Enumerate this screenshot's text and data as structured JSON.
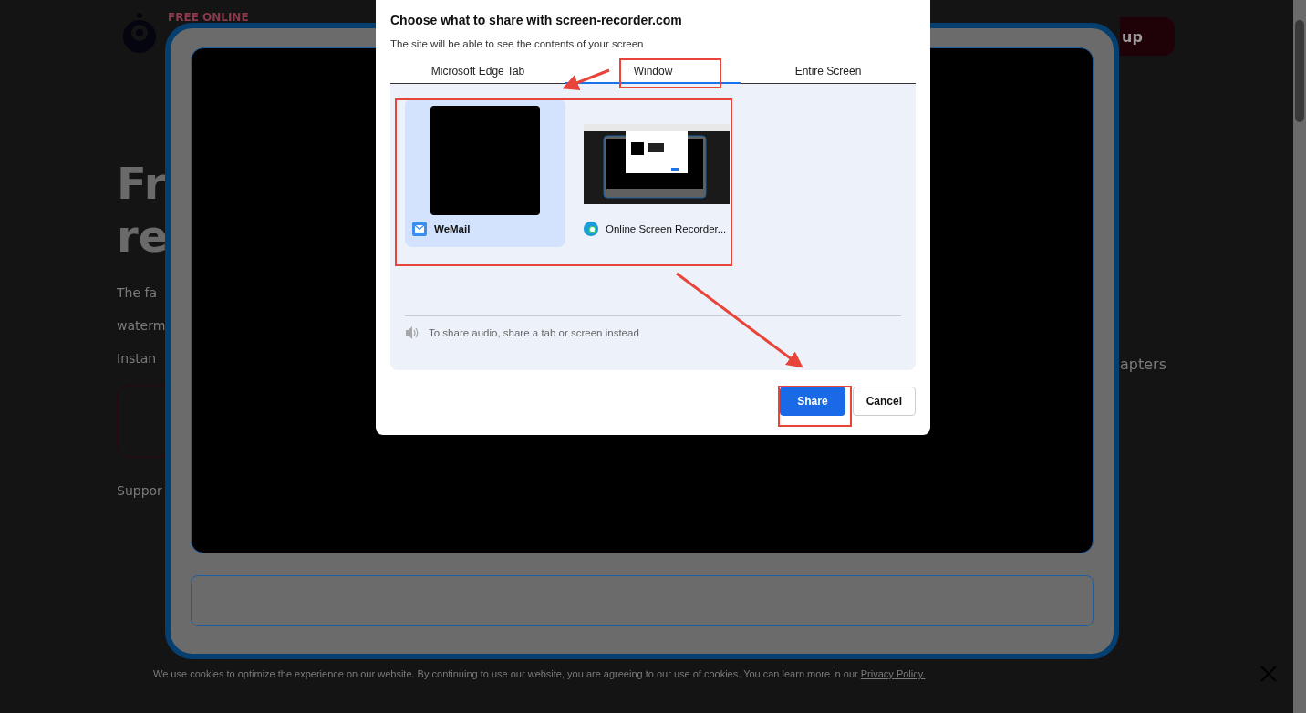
{
  "page": {
    "logo_text": "FREE ONLINE",
    "heading_lines": [
      "Fr",
      "re"
    ],
    "paragraph_lines": [
      "The fa",
      "waterm",
      "Instan"
    ],
    "support_text": "Suppor",
    "signup_button": "up",
    "right_text": "apters"
  },
  "cookie_banner": {
    "text": "We use cookies to optimize the experience on our website. By continuing to use our website, you are agreeing to our use of cookies. You can learn more in our",
    "link": "Privacy Policy."
  },
  "dialog": {
    "title": "Choose what to share with screen-recorder.com",
    "subtitle": "The site will be able to see the contents of your screen",
    "tabs": [
      {
        "label": "Microsoft Edge Tab",
        "selected": false
      },
      {
        "label": "Window",
        "selected": true
      },
      {
        "label": "Entire Screen",
        "selected": false
      }
    ],
    "sources": [
      {
        "name": "WeMail",
        "kind": "mail",
        "selected": true
      },
      {
        "name": "Online Screen Recorder...",
        "kind": "browser",
        "selected": false
      }
    ],
    "audio_note": "To share audio, share a tab or screen instead",
    "buttons": [
      {
        "label": "Share",
        "kind": "primary"
      },
      {
        "label": "Cancel",
        "kind": "secondary"
      }
    ]
  }
}
